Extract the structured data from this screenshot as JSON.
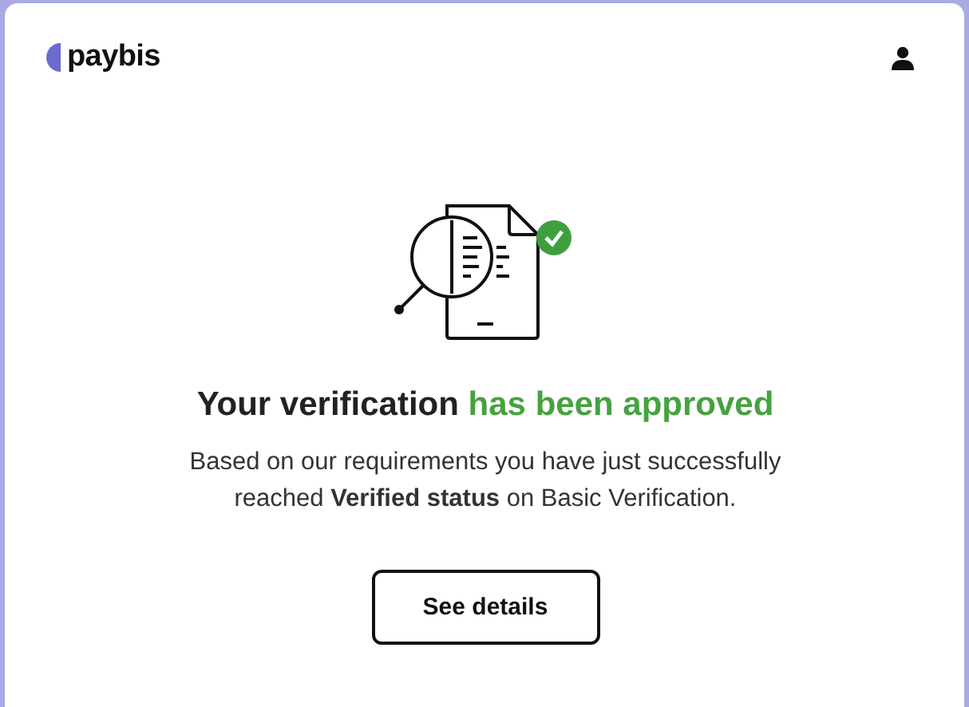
{
  "header": {
    "logo": "paybis"
  },
  "title": {
    "text": "Your verification ",
    "highlight": "has been approved"
  },
  "message": "Based on our requirements you have just successfully reached **Verified status** on Basic Verification.",
  "button": "See details"
}
